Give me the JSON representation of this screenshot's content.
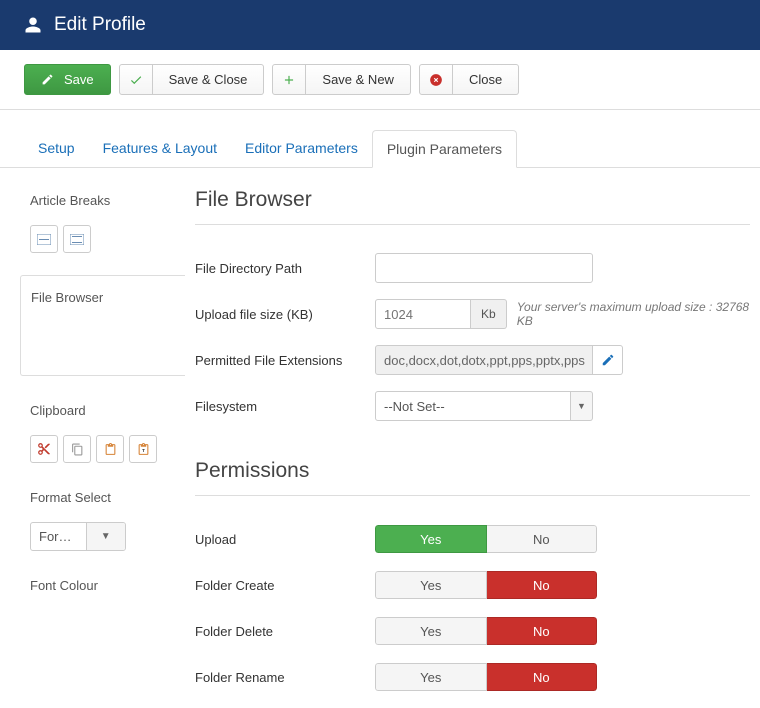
{
  "header": {
    "title": "Edit Profile"
  },
  "toolbar": {
    "save": "Save",
    "save_close": "Save & Close",
    "save_new": "Save & New",
    "close": "Close"
  },
  "tabs": {
    "setup": "Setup",
    "features": "Features & Layout",
    "editor": "Editor Parameters",
    "plugin": "Plugin Parameters"
  },
  "sidebar": {
    "article_breaks": "Article Breaks",
    "file_browser": "File Browser",
    "clipboard": "Clipboard",
    "format_select": "Format Select",
    "format_select_value": "Format S…",
    "font_colour": "Font Colour"
  },
  "main": {
    "file_browser_title": "File Browser",
    "file_dir_label": "File Directory Path",
    "upload_size_label": "Upload file size (KB)",
    "upload_size_value": "1024",
    "upload_size_suffix": "Kb",
    "upload_size_hint": "Your server's maximum upload size : 32768 KB",
    "perm_ext_label": "Permitted File Extensions",
    "perm_ext_value": "doc,docx,dot,dotx,ppt,pps,pptx,pps",
    "filesystem_label": "Filesystem",
    "filesystem_value": "--Not Set--",
    "permissions_title": "Permissions",
    "perm_upload": "Upload",
    "perm_folder_create": "Folder Create",
    "perm_folder_delete": "Folder Delete",
    "perm_folder_rename": "Folder Rename",
    "yes": "Yes",
    "no": "No"
  }
}
